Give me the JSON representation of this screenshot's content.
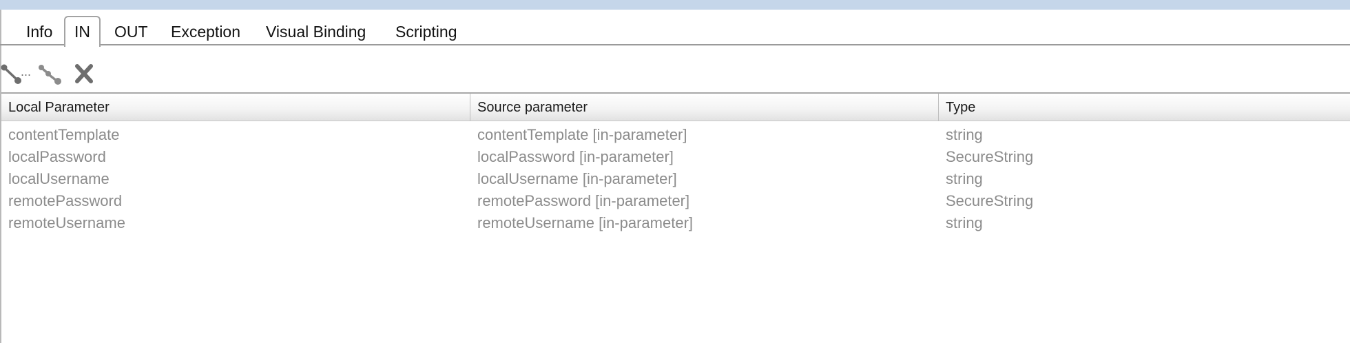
{
  "tabs": [
    {
      "label": "Info",
      "active": false
    },
    {
      "label": "IN",
      "active": true
    },
    {
      "label": "OUT",
      "active": false
    },
    {
      "label": "Exception",
      "active": false
    },
    {
      "label": "Visual Binding",
      "active": false
    },
    {
      "label": "Scripting",
      "active": false
    }
  ],
  "toolbar": {
    "buttons": [
      {
        "icon": "bind-parameter-icon",
        "label": "..."
      },
      {
        "icon": "unbind-parameter-icon"
      },
      {
        "icon": "delete-icon"
      }
    ]
  },
  "table": {
    "columns": [
      "Local Parameter",
      "Source parameter",
      "Type"
    ],
    "rows": [
      [
        "contentTemplate",
        "contentTemplate [in-parameter]",
        "string"
      ],
      [
        "localPassword",
        "localPassword [in-parameter]",
        "SecureString"
      ],
      [
        "localUsername",
        "localUsername [in-parameter]",
        "string"
      ],
      [
        "remotePassword",
        "remotePassword [in-parameter]",
        "SecureString"
      ],
      [
        "remoteUsername",
        "remoteUsername [in-parameter]",
        "string"
      ]
    ]
  },
  "colors": {
    "top_bar": "#c5d6ea",
    "cell_text": "#8c8c8c",
    "icon_gray": "#6e6e6e"
  }
}
